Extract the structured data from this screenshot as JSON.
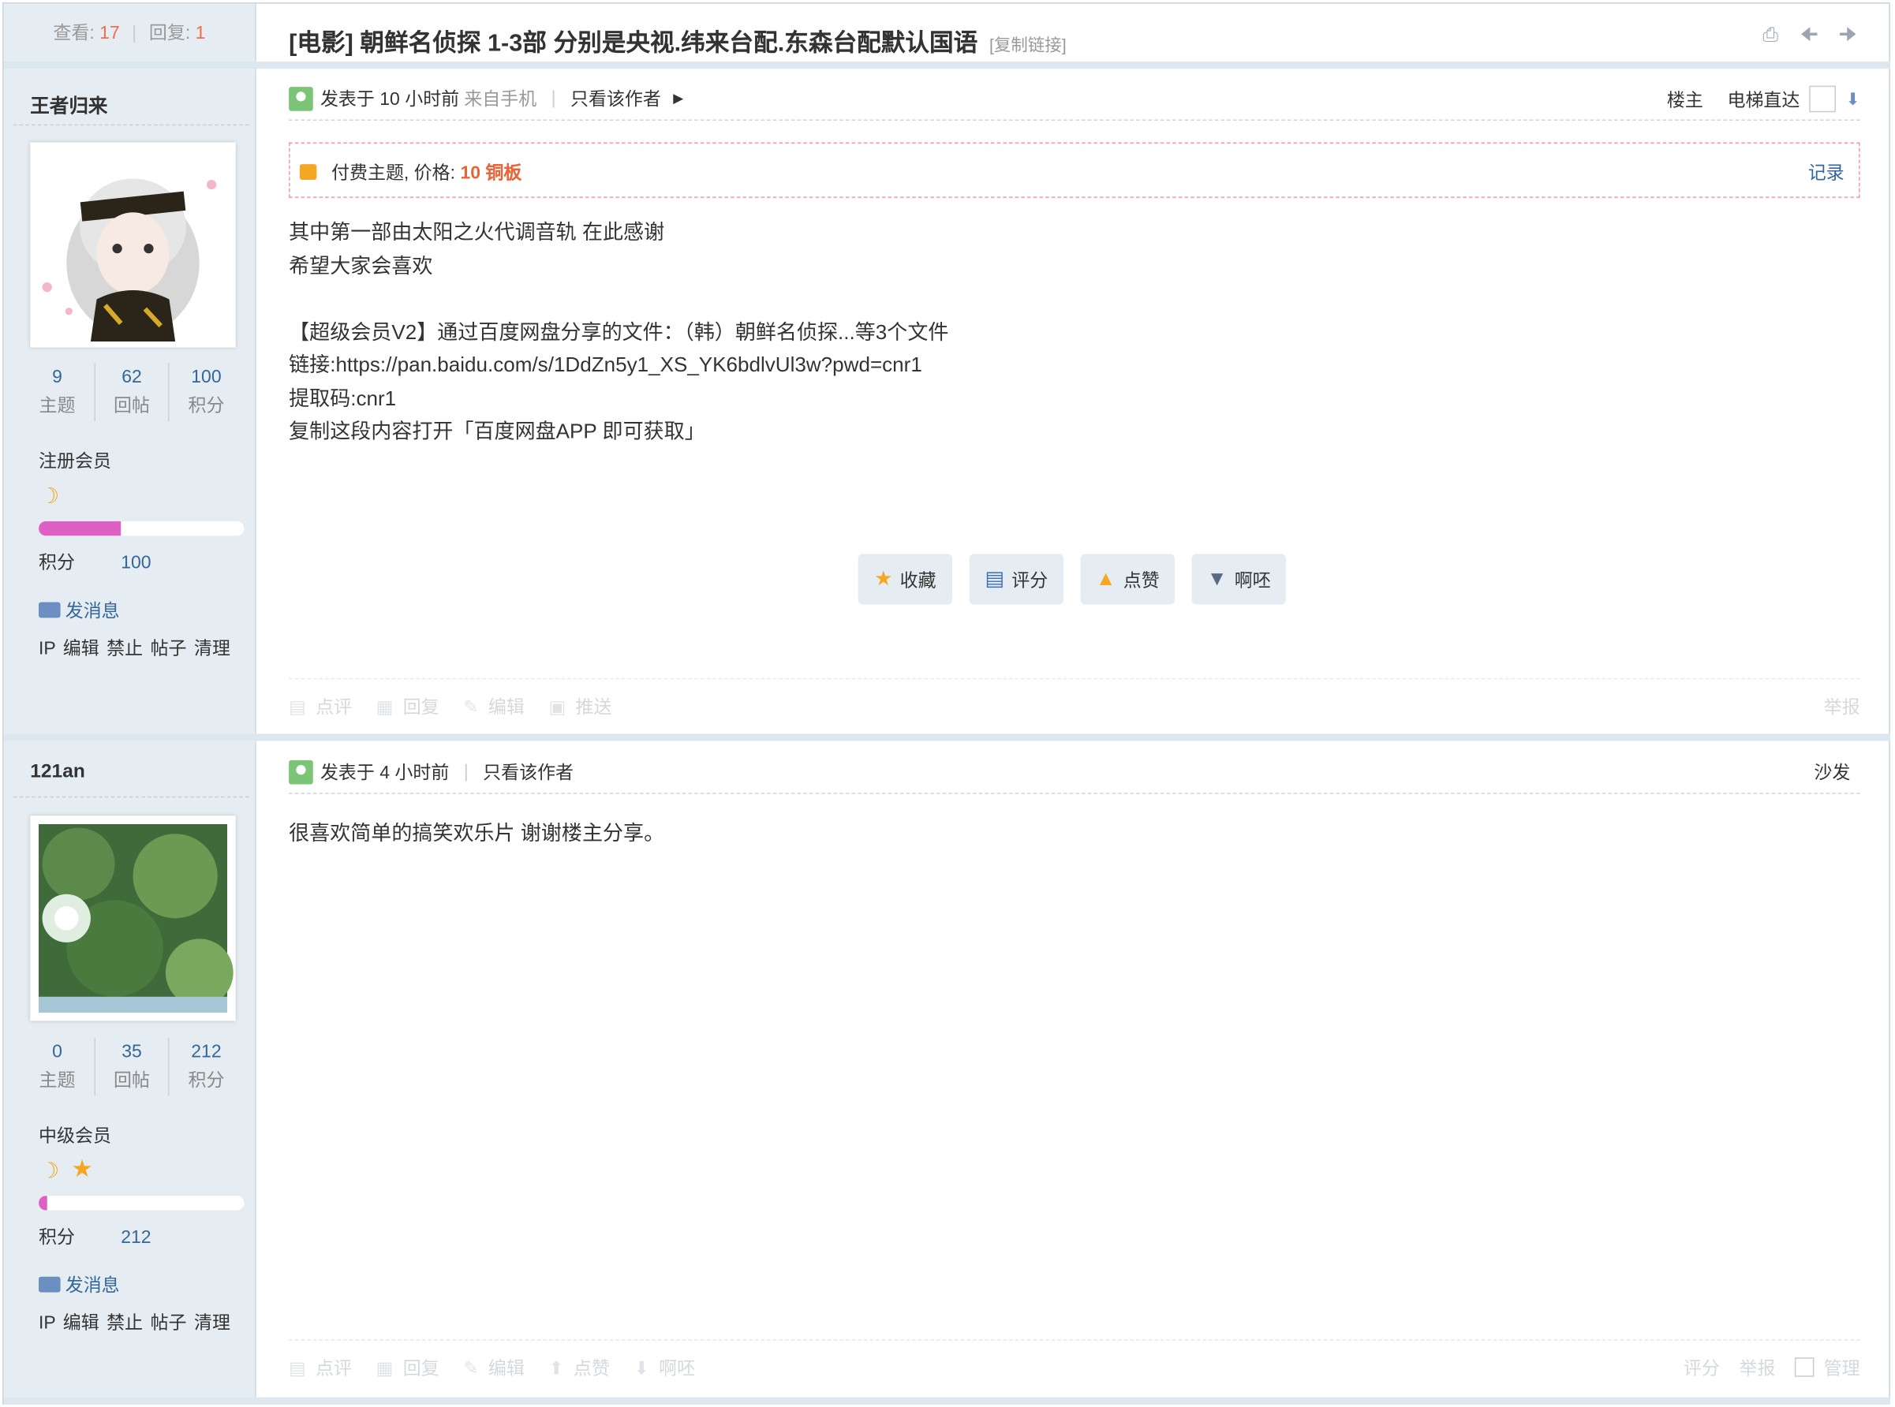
{
  "thread_stats": {
    "views_label": "查看:",
    "views": "17",
    "replies_label": "回复:",
    "replies": "1"
  },
  "thread": {
    "title": "[电影] 朝鲜名侦探 1-3部 分别是央视.纬来台配.东森台配默认国语",
    "copy_link": "[复制链接]",
    "icons": [
      "print-icon",
      "prev-thread-icon",
      "next-thread-icon"
    ]
  },
  "posts": [
    {
      "author": "王者归来",
      "stats": [
        {
          "value": "9",
          "label": "主题"
        },
        {
          "value": "62",
          "label": "回帖"
        },
        {
          "value": "100",
          "label": "积分"
        }
      ],
      "group": "注册会员",
      "progress": 0.4,
      "points_label": "积分",
      "points": "100",
      "pm": "发消息",
      "admin": "IP 编辑 禁止 帖子 清理",
      "posted": "发表于 10 小时前",
      "source": "来自手机",
      "only_author": "只看该作者",
      "floor": "楼主",
      "elevator": "电梯直达",
      "pay": {
        "label": "付费主题, 价格:",
        "price": "10 铜板",
        "record": "记录"
      },
      "content": "其中第一部由太阳之火代调音轨 在此感谢\n希望大家会喜欢\n\n【超级会员V2】通过百度网盘分享的文件：（韩）朝鲜名侦探...等3个文件\n链接:https://pan.baidu.com/s/1DdZn5y1_XS_YK6bdlvUl3w?pwd=cnr1\n提取码:cnr1\n复制这段内容打开「百度网盘APP 即可获取」",
      "actions": [
        "收藏",
        "评分",
        "点赞",
        "啊呸"
      ],
      "footer": [
        "点评",
        "回复",
        "编辑",
        "推送"
      ],
      "footer_right": [
        "举报"
      ]
    },
    {
      "author": "121an",
      "stats": [
        {
          "value": "0",
          "label": "主题"
        },
        {
          "value": "35",
          "label": "回帖"
        },
        {
          "value": "212",
          "label": "积分"
        }
      ],
      "group": "中级会员",
      "progress": 0.04,
      "points_label": "积分",
      "points": "212",
      "pm": "发消息",
      "admin": "IP 编辑 禁止 帖子 清理",
      "posted": "发表于 4 小时前",
      "only_author": "只看该作者",
      "floor": "沙发",
      "content": "很喜欢简单的搞笑欢乐片 谢谢楼主分享。",
      "footer": [
        "点评",
        "回复",
        "编辑",
        "点赞",
        "啊呸"
      ],
      "footer_right": [
        "评分",
        "举报",
        "管理"
      ]
    }
  ]
}
